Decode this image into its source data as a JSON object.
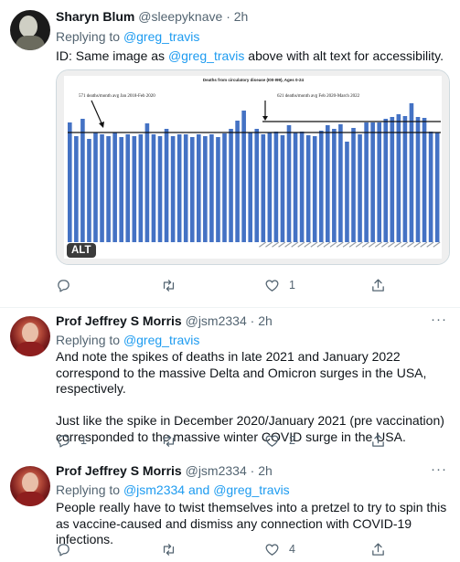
{
  "tweets": [
    {
      "author_name": "Sharyn Blum",
      "handle": "@sleepyknave",
      "time": "2h",
      "replying_label": "Replying to",
      "replying_to": "@greg_travis",
      "body_prefix": "ID: Same image as ",
      "body_mention": "@greg_travis",
      "body_suffix": " above with alt text for accessibility.",
      "alt_badge": "ALT",
      "reply_count": "",
      "retweet_count": "",
      "like_count": "1",
      "chart_image": {
        "title": "Deaths from circulatory disease (I00-I99), Ages 0-24",
        "annotation_left": "571 deaths/month avg Jan 2018-Feb 2020",
        "annotation_right": "621 deaths/month avg Feb 2020-March 2022"
      }
    },
    {
      "author_name": "Prof Jeffrey S Morris",
      "handle": "@jsm2334",
      "time": "2h",
      "replying_label": "Replying to",
      "replying_to": "@greg_travis",
      "paragraph_1": "And note the spikes of deaths in late 2021 and January 2022 correspond to the massive Delta and Omicron surges in the USA, respectively.",
      "paragraph_2": "Just like the spike in December 2020/January 2021 (pre vaccination) corresponded to the massive winter COVID surge in the USA.",
      "reply_count": "1",
      "retweet_count": "",
      "like_count": "2"
    },
    {
      "author_name": "Prof Jeffrey S Morris",
      "handle": "@jsm2334",
      "time": "2h",
      "replying_label": "Replying to",
      "replying_to_1": "@jsm2334",
      "replying_and": "and",
      "replying_to_2": "@greg_travis",
      "paragraph_1": "People really have to twist themselves into a pretzel to try to spin this as vaccine-caused and dismiss any connection with COVID-19 infections.",
      "reply_count": "",
      "retweet_count": "",
      "like_count": "4"
    }
  ],
  "ui": {
    "dot": "·",
    "more_icon": "···"
  },
  "colors": {
    "link": "#1d9bf0",
    "secondary": "#536471",
    "bar": "#4472c4",
    "border": "#eff3f4"
  }
}
